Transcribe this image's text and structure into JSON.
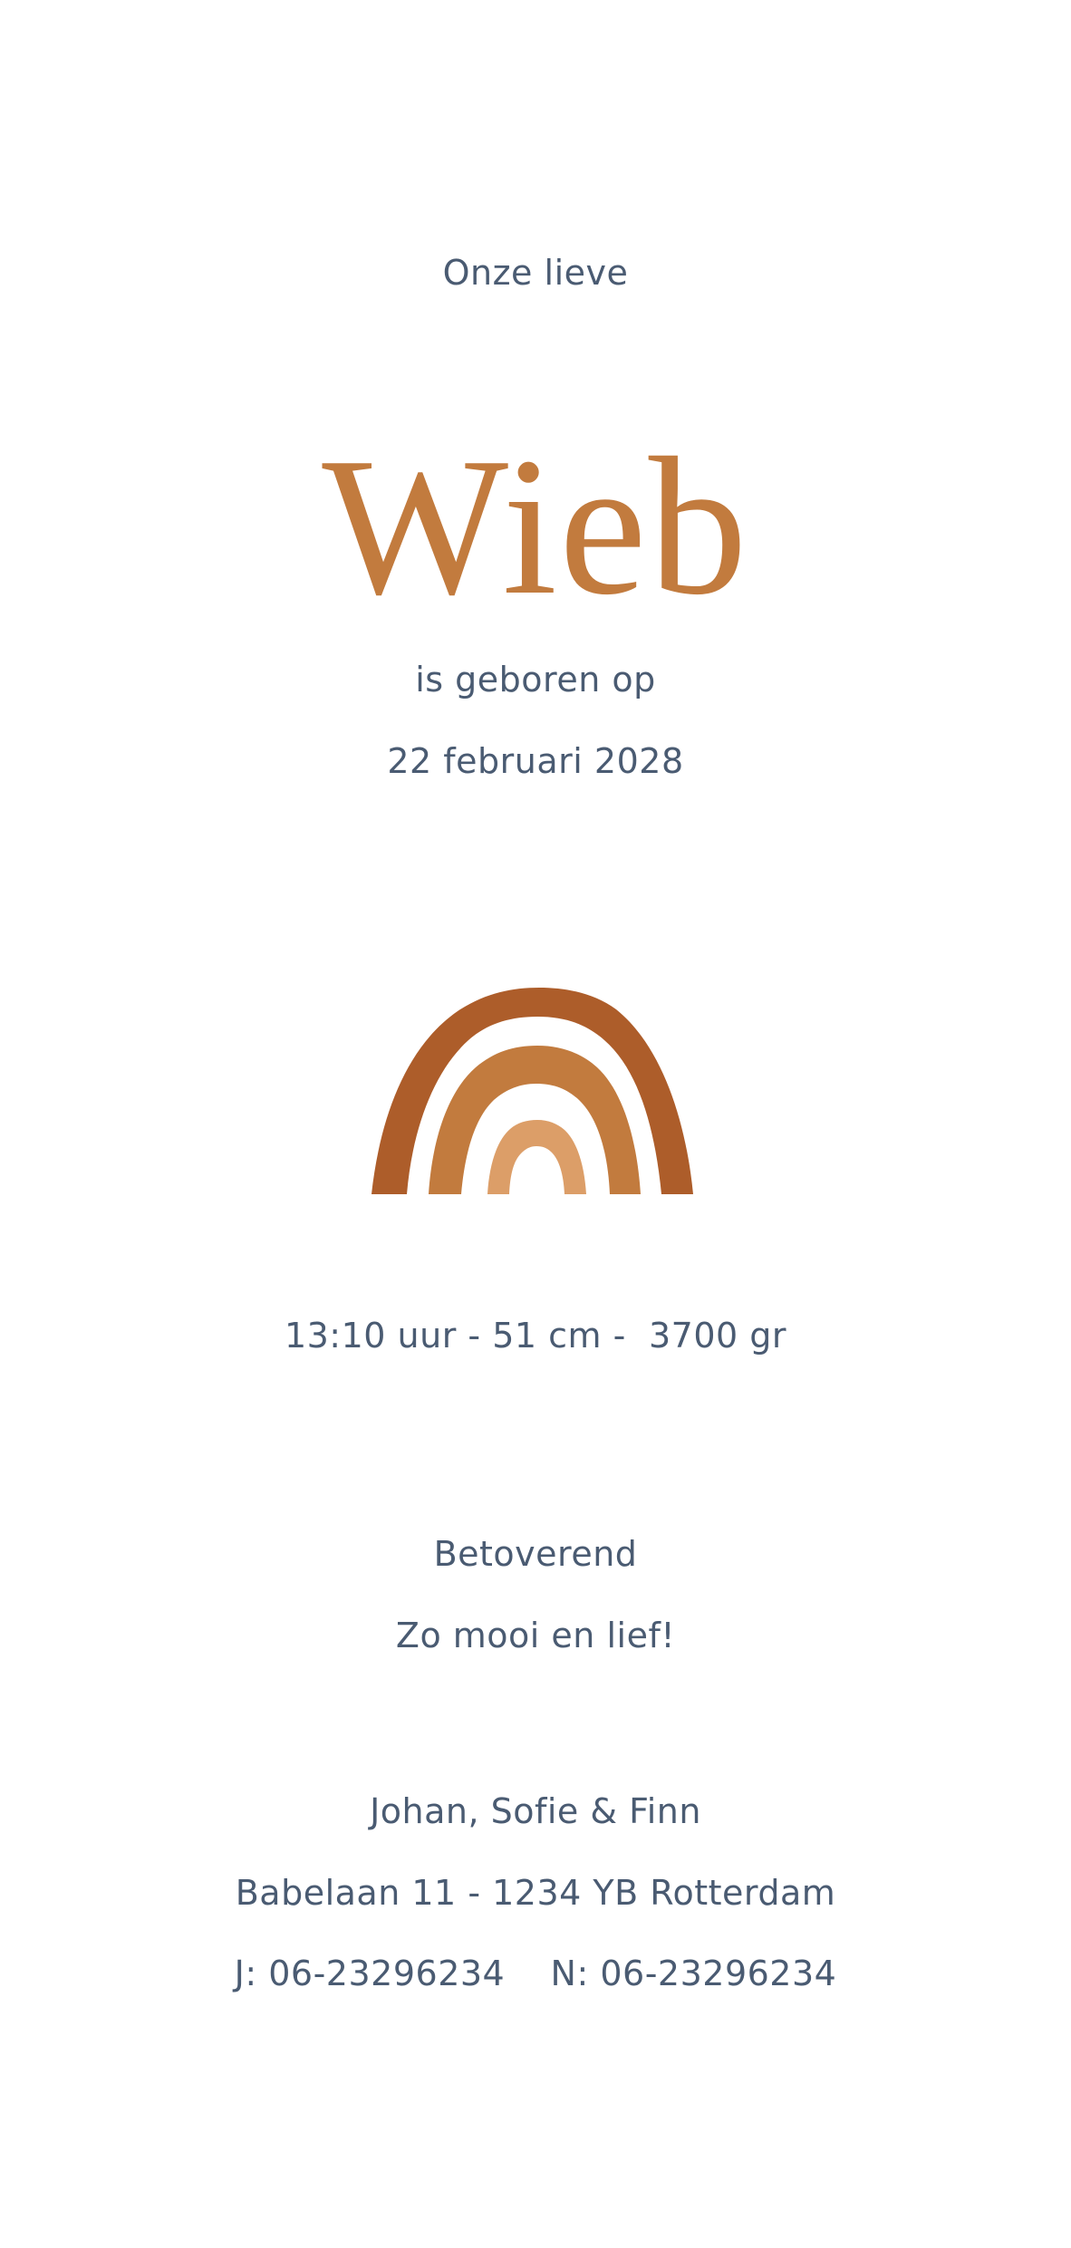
{
  "card": {
    "intro": "Onze lieve",
    "name": "Wieb",
    "born_text": "is geboren op",
    "date": "22 februari 2028",
    "birth_stats": "13:10 uur - 51 cm -  3700 gr",
    "meaning_word": "Betoverend",
    "message": "Zo mooi en lief!",
    "parents": "Johan, Sofie & Finn",
    "address": "Babelaan 11 - 1234 YB Rotterdam",
    "phones": "J: 06-23296234    N: 06-23296234"
  },
  "illustration": {
    "icon": "rainbow-icon",
    "colors": [
      "#ad5d2a",
      "#c27b3e",
      "#dc9e68"
    ]
  },
  "colors": {
    "text": "#4a5b72",
    "name": "#c27b3e",
    "background": "#ffffff"
  }
}
